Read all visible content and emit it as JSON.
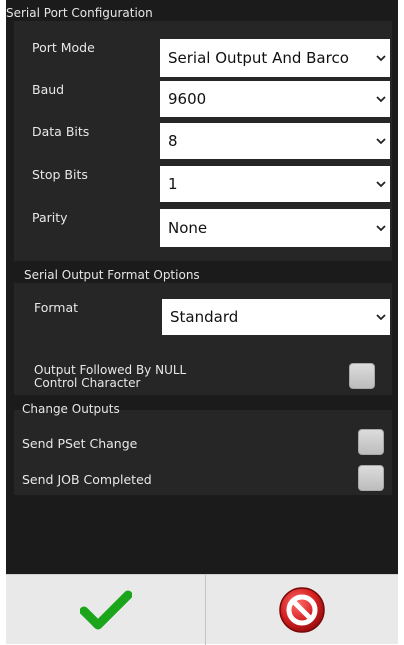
{
  "serial_port": {
    "title": "Serial Port Configuration",
    "port_mode": {
      "label": "Port Mode",
      "value": "Serial Output And Barco"
    },
    "baud": {
      "label": "Baud",
      "value": "9600"
    },
    "data_bits": {
      "label": "Data Bits",
      "value": "8"
    },
    "stop_bits": {
      "label": "Stop Bits",
      "value": "1"
    },
    "parity": {
      "label": "Parity",
      "value": "None"
    }
  },
  "output_format": {
    "title": "Serial Output Format Options",
    "format": {
      "label": "Format",
      "value": "Standard"
    },
    "null_char": {
      "label_line1": "Output Followed By NULL",
      "label_line2": "Control Character",
      "checked": false
    }
  },
  "change_outputs": {
    "title": "Change Outputs",
    "pset_change": {
      "label": "Send PSet Change",
      "checked": false
    },
    "job_completed": {
      "label": "Send JOB Completed",
      "checked": false
    }
  },
  "footer": {
    "ok_icon": "checkmark-icon",
    "cancel_icon": "no-entry-icon",
    "colors": {
      "ok": "#1aa51a",
      "cancel": "#d42020"
    }
  }
}
